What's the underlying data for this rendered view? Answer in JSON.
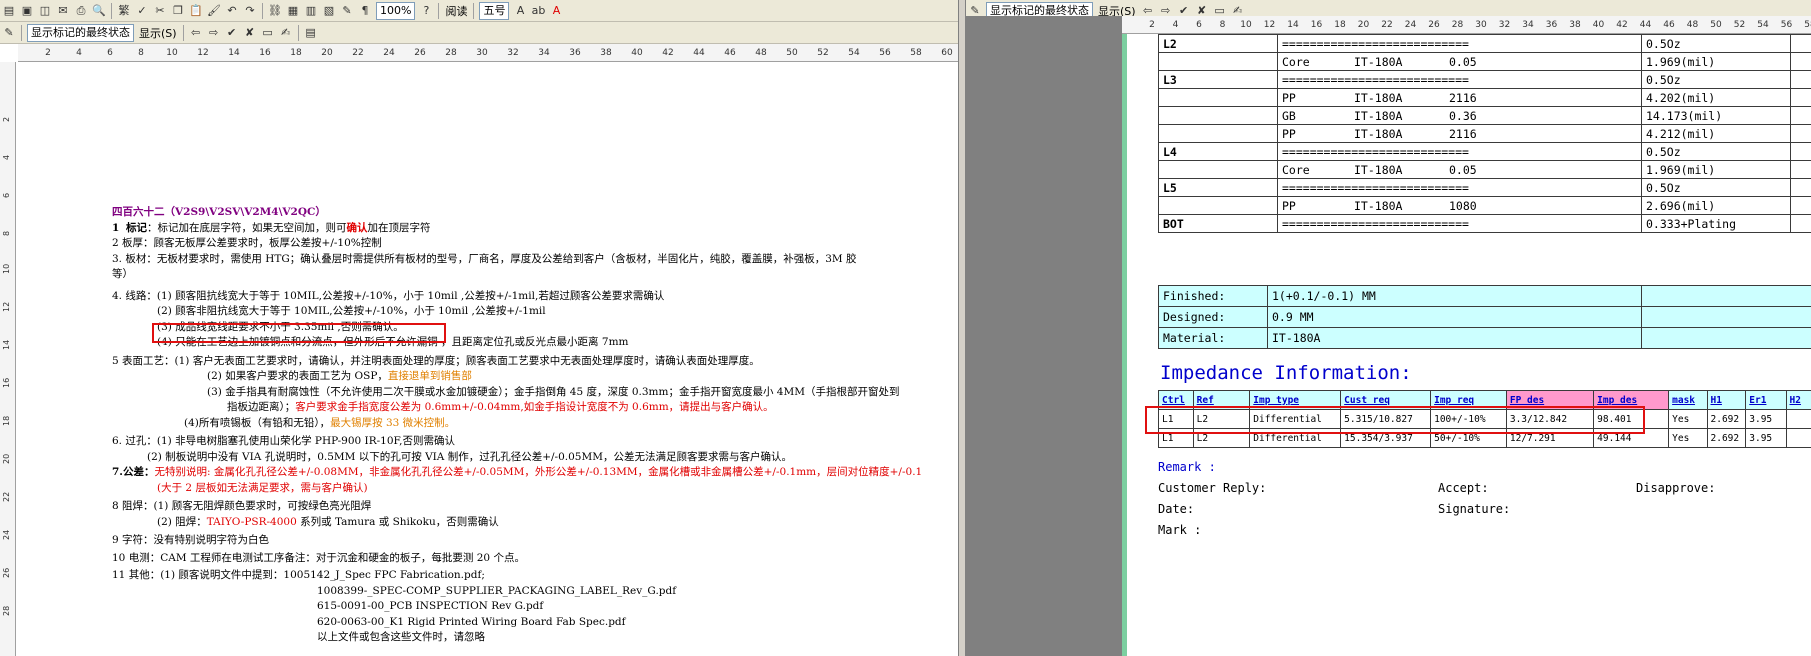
{
  "left": {
    "toolbar1": {
      "zoom": "100%",
      "read_mode": "阅读",
      "font_size": "五号"
    },
    "toolbar2": {
      "markup_view": "显示标记的最终状态",
      "show_menu": "显示(S)"
    },
    "ruler_ticks": [
      "2",
      "4",
      "6",
      "8",
      "10",
      "12",
      "14",
      "16",
      "18",
      "20",
      "22",
      "24",
      "26",
      "28",
      "30",
      "32",
      "34",
      "36",
      "38",
      "40",
      "42",
      "44",
      "46",
      "48",
      "50",
      "52",
      "54",
      "56",
      "58",
      "60"
    ],
    "vruler_ticks": [
      "2",
      "4",
      "6",
      "8",
      "10",
      "12",
      "14",
      "16",
      "18",
      "20",
      "22",
      "24",
      "26",
      "28"
    ],
    "doc": {
      "title": "四百六十二（V2S9\\V2SV\\V2M4\\V2QC）",
      "l1_num": "1",
      "l1_label": "标记",
      "l1_a": "：标记加在底层字符，如果无空间加，则可",
      "l1_red": "确认",
      "l1_b": "加在顶层字符",
      "l2": "2  板厚：顾客无板厚公差要求时，板厚公差按+/-10%控制",
      "l3": "3.  板材：无板材要求时，需使用 HTG；确认叠层时需提供所有板材的型号，厂商名，厚度及公差给到客户（含板材，半固化片，纯胶，覆盖膜，补强板，3M 胶",
      "l3b": "等）",
      "l4": "4.  线路：(1) 顾客阻抗线宽大于等于 10MIL,公差按+/-10%，小于 10mil ,公差按+/-1mil,若超过顾客公差要求需确认",
      "l4b": "(2) 顾客非阻抗线宽大于等于 10MIL,公差按+/-10%，小于 10mil ,公差按+/-1mil",
      "l4c": "(3) 成品线宽线距要求不小于 3.35mil ,否则需确认。",
      "l4d": "(4) 只能在工艺边上加镀铜点和分流点，但外形后不允许漏铜 ，且距离定位孔或反光点最小距离 7mm",
      "l5": "5  表面工艺：(1) 客户无表面工艺要求时，请确认，并注明表面处理的厚度；顾客表面工艺要求中无表面处理厚度时，请确认表面处理厚度。",
      "l5b_a": "(2) 如果客户要求的表面工艺为 OSP，",
      "l5b_o": "直接退单到销售部",
      "l5c": "(3) 金手指具有耐腐蚀性（不允许使用二次干膜或水金加镀硬金）；金手指倒角 45 度，深度 0.3mm；金手指开窗宽度最小 4MM（手指根部开窗处到",
      "l5d_a": "指板边距离）；",
      "l5d_r": "客户要求金手指宽度公差为 0.6mm+/-0.04mm,如金手指设计宽度不为 0.6mm，请提出与客户确认。",
      "l5e_a": "(4)所有喷锡板（有铅和无铅），",
      "l5e_o": "最大锡厚按 33 微米控制。",
      "l6": "6.  过孔：(1) 非导电树脂塞孔使用山荣化学 PHP-900 IR-10F,否则需确认",
      "l6b": "(2) 制板说明中没有 VIA 孔说明时，0.5MM 以下的孔可按 VIA 制作，过孔孔径公差+/-0.05MM，公差无法满足顾客要求需与客户确认。",
      "l7_a": "7.公差：",
      "l7_r": "无特别说明: 金属化孔孔径公差+/-0.08MM，非金属化孔孔径公差+/-0.05MM，外形公差+/-0.13MM，金属化槽或非金属槽公差+/-0.1mm，层间对位精度+/-0.1",
      "l7b": "(大于 2 层板如无法满足要求，需与客户确认)",
      "l8": "8  阻焊：(1) 顾客无阻焊颜色要求时，可按绿色亮光阻焊",
      "l8b_a": "(2) 阻焊：",
      "l8b_r": "TAIYO-PSR-4000",
      "l8b_b": " 系列或 Tamura 或 Shikoku，否则需确认",
      "l9": "9  字符：没有特别说明字符为白色",
      "l10": "10  电测：CAM 工程师在电测试工序备注：对于沉金和硬金的板子，每批要测 20 个点。",
      "l11": "11 其他：(1) 顾客说明文件中提到：1005142_J_Spec FPC Fabrication.pdf;",
      "l11b": "1008399-_SPEC-COMP_SUPPLIER_PACKAGING_LABEL_Rev_G.pdf",
      "l11c": "615-0091-00_PCB INSPECTION Rev G.pdf",
      "l11d": "620-0063-00_K1 Rigid Printed Wiring Board Fab Spec.pdf",
      "l11e": "以上文件或包含这些文件时，请忽略"
    }
  },
  "right": {
    "toolbar1": {
      "markup_view": "显示标记的最终状态",
      "show_menu": "显示(S)"
    },
    "ruler_ticks": [
      "2",
      "4",
      "6",
      "8",
      "10",
      "12",
      "14",
      "16",
      "18",
      "20",
      "22",
      "24",
      "26",
      "28",
      "30",
      "32",
      "34",
      "36",
      "38",
      "40",
      "42",
      "44",
      "46",
      "48",
      "50",
      "52",
      "54",
      "56",
      "58"
    ],
    "stackup": [
      {
        "layer": "L2",
        "mat": "",
        "type": "",
        "spec": "===========================",
        "val": "0.5Oz"
      },
      {
        "layer": "",
        "mat": "Core",
        "type": "IT-180A",
        "spec": "0.05",
        "val": "1.969(mil)"
      },
      {
        "layer": "L3",
        "mat": "",
        "type": "",
        "spec": "===========================",
        "val": "0.5Oz"
      },
      {
        "layer": "",
        "mat": "PP",
        "type": "IT-180A",
        "spec": "2116",
        "val": "4.202(mil)"
      },
      {
        "layer": "",
        "mat": "GB",
        "type": "IT-180A",
        "spec": "0.36",
        "val": "14.173(mil)"
      },
      {
        "layer": "",
        "mat": "PP",
        "type": "IT-180A",
        "spec": "2116",
        "val": "4.212(mil)"
      },
      {
        "layer": "L4",
        "mat": "",
        "type": "",
        "spec": "===========================",
        "val": "0.5Oz"
      },
      {
        "layer": "",
        "mat": "Core",
        "type": "IT-180A",
        "spec": "0.05",
        "val": "1.969(mil)"
      },
      {
        "layer": "L5",
        "mat": "",
        "type": "",
        "spec": "===========================",
        "val": "0.5Oz"
      },
      {
        "layer": "",
        "mat": "PP",
        "type": "IT-180A",
        "spec": "1080",
        "val": "2.696(mil)"
      },
      {
        "layer": "BOT",
        "mat": "",
        "type": "",
        "spec": "===========================",
        "val": "0.333+Plating"
      }
    ],
    "specs": [
      {
        "label": "Finished:",
        "value": "1(+0.1/-0.1) MM"
      },
      {
        "label": "Designed:",
        "value": "0.9 MM"
      },
      {
        "label": "Material:",
        "value": "IT-180A"
      }
    ],
    "imp_title": "Impedance Information:",
    "imp_headers": [
      "Ctrl",
      "Ref",
      "Imp type",
      "Cust req",
      "Imp req",
      "FP des",
      "Imp des",
      "mask",
      "H1",
      "Er1",
      "H2"
    ],
    "imp_rows": [
      [
        "L1",
        "L2",
        "Differential",
        "5.315/10.827",
        "100+/-10%",
        "3.3/12.842",
        "98.401",
        "Yes",
        "2.692",
        "3.95",
        ""
      ],
      [
        "L1",
        "L2",
        "Differential",
        "15.354/3.937",
        "50+/-10%",
        "12/7.291",
        "49.144",
        "Yes",
        "2.692",
        "3.95",
        ""
      ]
    ],
    "remark": "Remark :",
    "customer_reply": "Customer Reply:",
    "accept": "Accept:",
    "disapprove": "Disapprove:",
    "date": "Date:",
    "signature": "Signature:",
    "mark": "Mark :"
  }
}
